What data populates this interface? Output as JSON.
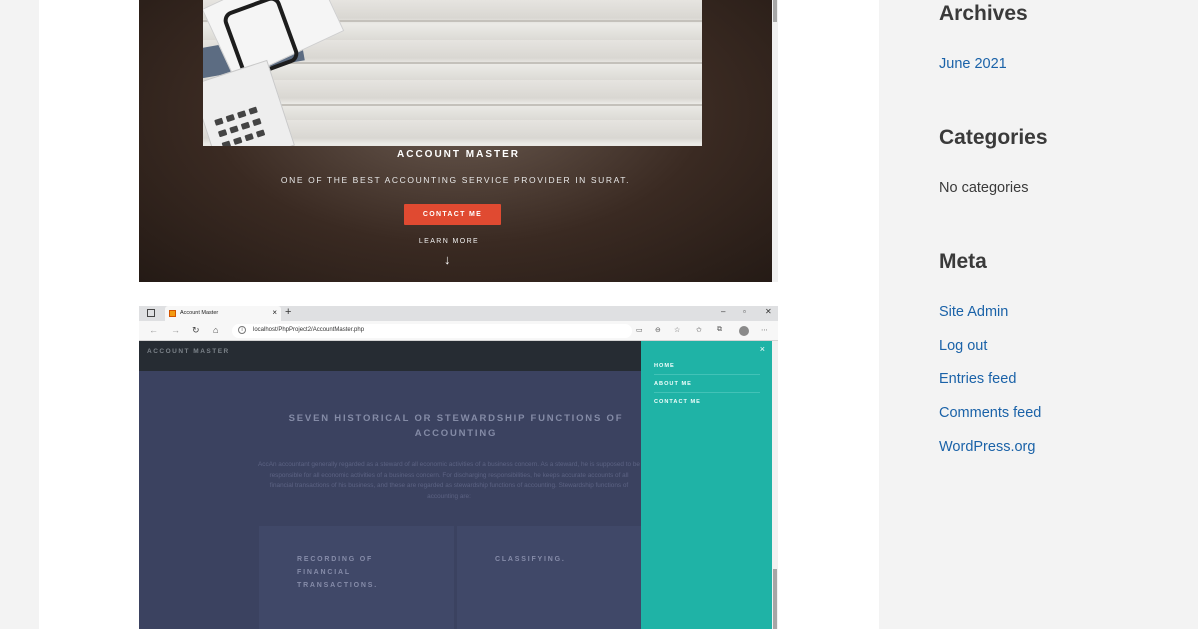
{
  "hero": {
    "title": "ACCOUNT MASTER",
    "subtitle": "ONE OF THE BEST ACCOUNTING SERVICE PROVIDER IN SURAT.",
    "cta_label": "CONTACT ME",
    "learn_more": "LEARN MORE",
    "arrow": "↓",
    "cta_color": "#e04a31"
  },
  "browser": {
    "tab_title": "Account Master",
    "tab_close": "×",
    "new_tab": "+",
    "window_controls": [
      "–",
      "▫",
      "✕"
    ],
    "nav": [
      "←",
      "→",
      "↻",
      "⌂"
    ],
    "url": "localhost/PhpProject2/AccountMaster.php",
    "tools": [
      "▭",
      "⊖",
      "☆",
      "✩",
      "⧉",
      "⋯"
    ]
  },
  "site": {
    "brand": "ACCOUNT MASTER",
    "heading": "SEVEN HISTORICAL OR STEWARDSHIP FUNCTIONS OF ACCOUNTING",
    "paragraph": "AccAn accountant generally regarded as a steward of all economic activities of a business concern. As a steward, he is supposed to be responsible for all economic activities of a business concern. For discharging responsibilities, he keeps accurate accounts of all financial transactions of his business, and these are regarded as stewardship functions of accounting. Stewardship functions of accounting are:",
    "columns": [
      "RECORDING OF FINANCIAL TRANSACTIONS.",
      "CLASSIFYING."
    ],
    "menu_close": "×",
    "menu": [
      "HOME",
      "ABOUT ME",
      "CONTACT ME"
    ],
    "menu_color": "#1fb3a6"
  },
  "sidebar": {
    "archives": {
      "title": "Archives",
      "items": [
        "June 2021"
      ]
    },
    "categories": {
      "title": "Categories",
      "empty": "No categories"
    },
    "meta": {
      "title": "Meta",
      "items": [
        "Site Admin",
        "Log out",
        "Entries feed",
        "Comments feed",
        "WordPress.org"
      ]
    },
    "link_color": "#1a62a8"
  }
}
